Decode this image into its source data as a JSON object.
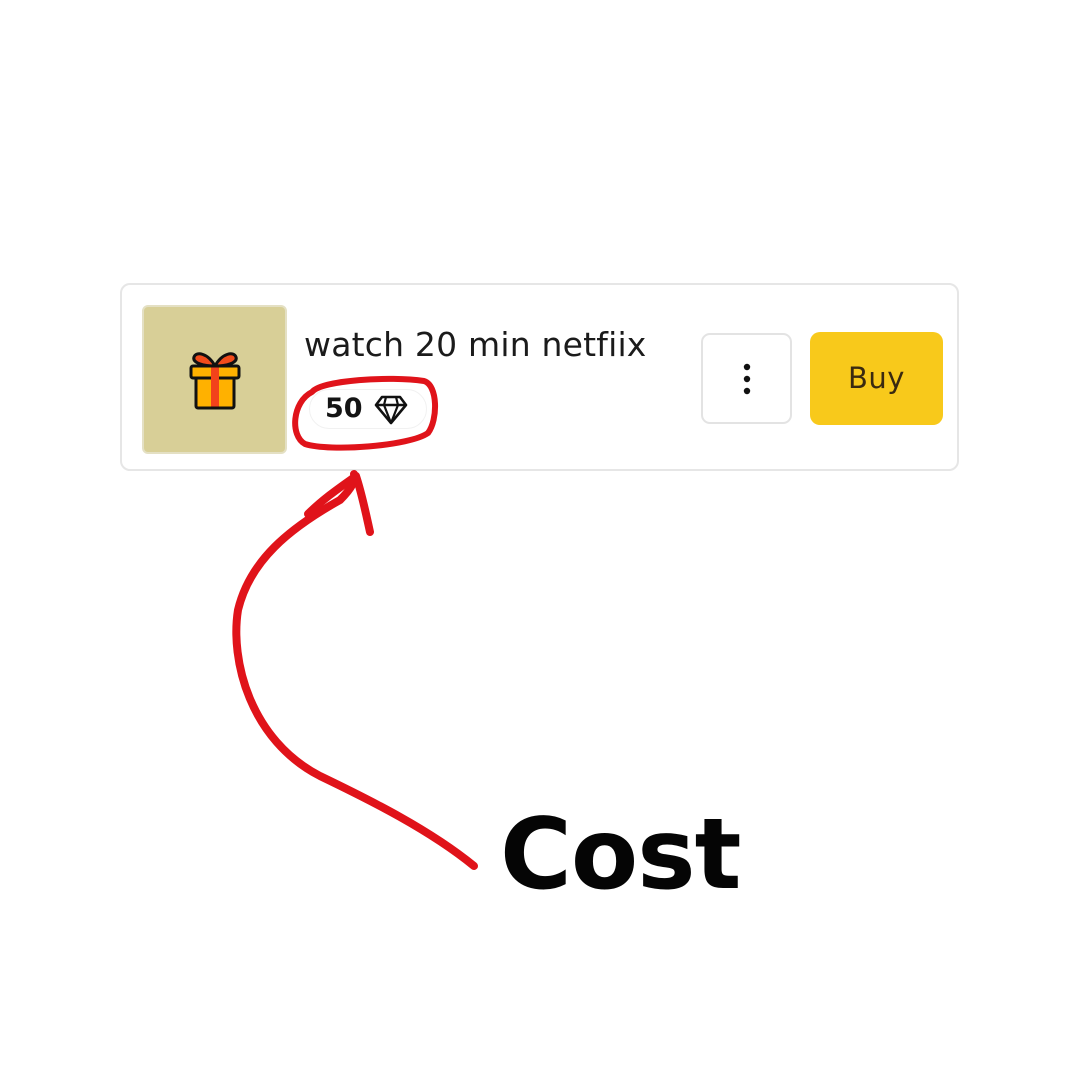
{
  "reward": {
    "title": "watch 20 min netfiix",
    "cost": "50",
    "cost_icon": "diamond-icon",
    "thumbnail_icon": "gift-icon",
    "more_icon": "vertical-dots-icon",
    "buy_label": "Buy"
  },
  "annotation": {
    "label": "Cost",
    "color": "#e0131a"
  },
  "colors": {
    "thumbnail_background": "#d8cf97",
    "buy_background": "#f8c91b",
    "card_border": "#e6e6e6"
  }
}
